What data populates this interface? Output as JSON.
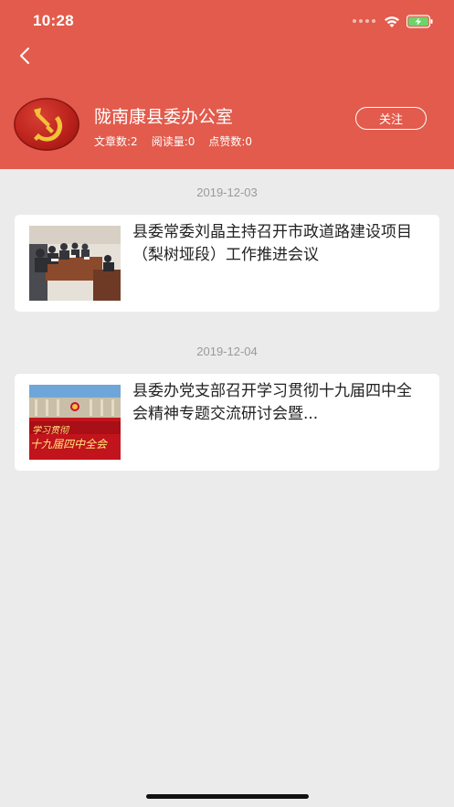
{
  "status_bar": {
    "time": "10:28"
  },
  "profile": {
    "name": "陇南康县委办公室",
    "stats": [
      "文章数:2",
      "阅读量:0",
      "点赞数:0"
    ],
    "follow_label": "关注"
  },
  "articles": [
    {
      "date": "2019-12-03",
      "title": "县委常委刘晶主持召开市政道路建设项目（梨树垭段）工作推进会议"
    },
    {
      "date": "2019-12-04",
      "title": "县委办党支部召开学习贯彻十九届四中全会精神专题交流研讨会暨...",
      "thumb_text": [
        "学习贯彻",
        "十九届四中全会"
      ]
    }
  ],
  "colors": {
    "header": "#e25b4c",
    "background": "#ebebeb"
  },
  "icons": [
    "back-arrow-icon",
    "wifi-icon",
    "battery-charging-icon",
    "party-emblem-avatar"
  ]
}
